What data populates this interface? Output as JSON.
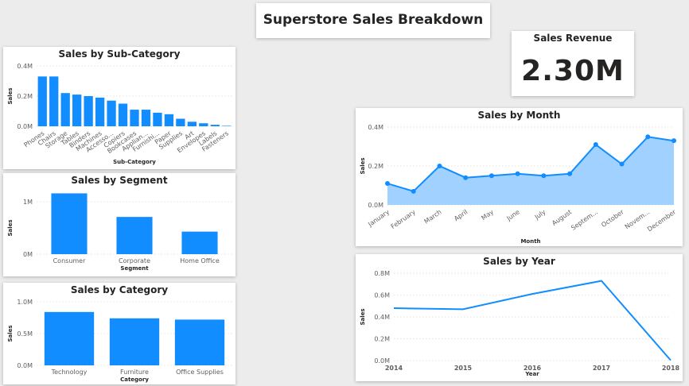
{
  "dashboard": {
    "title": "Superstore Sales Breakdown"
  },
  "kpi": {
    "label": "Sales Revenue",
    "value": "2.30M"
  },
  "colors": {
    "bar": "#118DFF",
    "area": "#A0D1FF",
    "line": "#118DFF"
  },
  "chart_data": [
    {
      "id": "subcategory",
      "type": "bar",
      "title": "Sales by Sub-Category",
      "xlabel": "Sub-Category",
      "ylabel": "Sales",
      "categories": [
        "Phones",
        "Chairs",
        "Storage",
        "Tables",
        "Binders",
        "Machines",
        "Accesso...",
        "Copiers",
        "Bookcases",
        "Applian...",
        "Furnishi...",
        "Paper",
        "Supplies",
        "Art",
        "Envelopes",
        "Labels",
        "Fasteners"
      ],
      "values": [
        0.33,
        0.33,
        0.22,
        0.21,
        0.2,
        0.19,
        0.17,
        0.15,
        0.11,
        0.11,
        0.09,
        0.08,
        0.05,
        0.03,
        0.02,
        0.01,
        0.003
      ],
      "yticks": [
        "0.0M",
        "0.2M",
        "0.4M"
      ],
      "ylim": [
        0,
        0.4
      ],
      "grid": true
    },
    {
      "id": "segment",
      "type": "bar",
      "title": "Sales by Segment",
      "xlabel": "Segment",
      "ylabel": "Sales",
      "categories": [
        "Consumer",
        "Corporate",
        "Home Office"
      ],
      "values": [
        1.16,
        0.71,
        0.43
      ],
      "yticks": [
        "0M",
        "1M"
      ],
      "ylim": [
        0,
        1.0
      ],
      "grid": true
    },
    {
      "id": "category",
      "type": "bar",
      "title": "Sales by Category",
      "xlabel": "Category",
      "ylabel": "Sales",
      "categories": [
        "Technology",
        "Furniture",
        "Office Supplies"
      ],
      "values": [
        0.84,
        0.74,
        0.72
      ],
      "yticks": [
        "0.0M",
        "0.5M",
        "1.0M"
      ],
      "ylim": [
        0,
        1.0
      ],
      "grid": true
    },
    {
      "id": "month",
      "type": "area",
      "title": "Sales by Month",
      "xlabel": "Month",
      "ylabel": "Sales",
      "categories": [
        "January",
        "February",
        "March",
        "April",
        "May",
        "June",
        "July",
        "August",
        "Septem...",
        "October",
        "Novem...",
        "December"
      ],
      "values": [
        0.11,
        0.07,
        0.2,
        0.14,
        0.15,
        0.16,
        0.15,
        0.16,
        0.31,
        0.21,
        0.35,
        0.33
      ],
      "yticks": [
        "0.0M",
        "0.2M",
        "0.4M"
      ],
      "ylim": [
        0,
        0.4
      ],
      "grid": true
    },
    {
      "id": "year",
      "type": "line",
      "title": "Sales by Year",
      "xlabel": "Year",
      "ylabel": "Sales",
      "categories": [
        "2014",
        "2015",
        "2016",
        "2017",
        "2018"
      ],
      "values": [
        0.48,
        0.47,
        0.61,
        0.73,
        0.003
      ],
      "yticks": [
        "0.0M",
        "0.2M",
        "0.4M",
        "0.6M",
        "0.8M"
      ],
      "ylim": [
        0,
        0.8
      ],
      "grid": true
    }
  ]
}
